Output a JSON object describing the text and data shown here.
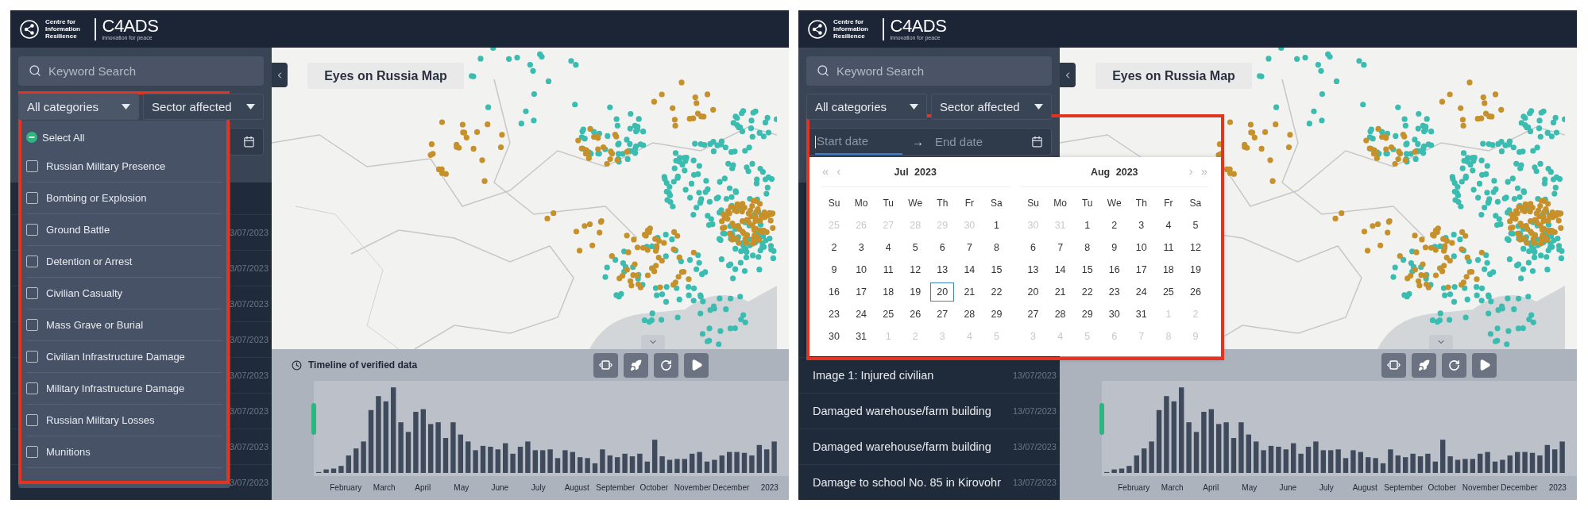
{
  "panels": [
    {
      "header": {
        "org_name": "Centre for Information Resilience",
        "brand": "C4ADS",
        "tagline": "innovation for peace"
      },
      "search": {
        "placeholder": "Keyword Search"
      },
      "filters": [
        {
          "label": "All categories",
          "open": true
        },
        {
          "label": "Sector affected",
          "open": false
        }
      ],
      "list": [
        {
          "date": "3/07/2023"
        },
        {
          "date": "3/07/2023"
        },
        {
          "date": "3/07/2023"
        },
        {
          "date": "3/07/2023"
        },
        {
          "date": "3/07/2023"
        },
        {
          "date": "3/07/2023"
        },
        {
          "date": "3/07/2023"
        },
        {
          "date": "3/07/2023"
        }
      ],
      "popup": {
        "kind": "category_menu",
        "annotated": true,
        "select_all": {
          "label": "Select All",
          "indeterminate": true
        },
        "options": [
          {
            "label": "Russian Military Presence",
            "checked": false
          },
          {
            "label": "Bombing or Explosion",
            "checked": false
          },
          {
            "label": "Ground Battle",
            "checked": false
          },
          {
            "label": "Detention or Arrest",
            "checked": false
          },
          {
            "label": "Civilian Casualty",
            "checked": false
          },
          {
            "label": "Mass Grave or Burial",
            "checked": false
          },
          {
            "label": "Civilian Infrastructure Damage",
            "checked": false
          },
          {
            "label": "Military Infrastructure Damage",
            "checked": false
          },
          {
            "label": "Russian Military Losses",
            "checked": false
          },
          {
            "label": "Munitions",
            "checked": false
          }
        ]
      },
      "map": {
        "title": "Eyes on Russia Map"
      },
      "timeline": {
        "title": "Timeline of verified data",
        "months": [
          "February",
          "March",
          "April",
          "May",
          "June",
          "July",
          "August",
          "September",
          "October",
          "November",
          "December",
          "2023"
        ]
      }
    },
    {
      "header": {
        "org_name": "Centre for Information Resilience",
        "brand": "C4ADS",
        "tagline": "innovation for peace"
      },
      "search": {
        "placeholder": "Keyword Search"
      },
      "filters": [
        {
          "label": "All categories",
          "open": false
        },
        {
          "label": "Sector affected",
          "open": false
        }
      ],
      "date_range": {
        "start_placeholder": "Start date",
        "separator": "→",
        "end_placeholder": "End date",
        "focused": true
      },
      "list": [
        {
          "title": "Image 1: Injured civilian",
          "date": "13/07/2023"
        },
        {
          "title": "Damaged warehouse/farm building",
          "date": "13/07/2023"
        },
        {
          "title": "Damaged warehouse/farm building",
          "date": "13/07/2023"
        },
        {
          "title": "Damage to school No. 85 in Kirovohr",
          "date": "13/07/2023"
        }
      ],
      "popup": {
        "kind": "calendar",
        "annotated": true,
        "months": [
          {
            "title": "Jul 2023",
            "nav": [
              "«",
              "‹"
            ],
            "weekdays": [
              "Su",
              "Mo",
              "Tu",
              "We",
              "Th",
              "Fr",
              "Sa"
            ],
            "weeks": [
              [
                {
                  "d": "25",
                  "muted": true,
                  "today": false
                },
                {
                  "d": "26",
                  "muted": true,
                  "today": false
                },
                {
                  "d": "27",
                  "muted": true,
                  "today": false
                },
                {
                  "d": "28",
                  "muted": true,
                  "today": false
                },
                {
                  "d": "29",
                  "muted": true,
                  "today": false
                },
                {
                  "d": "30",
                  "muted": true,
                  "today": false
                },
                {
                  "d": "1",
                  "muted": false,
                  "today": false
                }
              ],
              [
                {
                  "d": "2",
                  "muted": false,
                  "today": false
                },
                {
                  "d": "3",
                  "muted": false,
                  "today": false
                },
                {
                  "d": "4",
                  "muted": false,
                  "today": false
                },
                {
                  "d": "5",
                  "muted": false,
                  "today": false
                },
                {
                  "d": "6",
                  "muted": false,
                  "today": false
                },
                {
                  "d": "7",
                  "muted": false,
                  "today": false
                },
                {
                  "d": "8",
                  "muted": false,
                  "today": false
                }
              ],
              [
                {
                  "d": "9",
                  "muted": false,
                  "today": false
                },
                {
                  "d": "10",
                  "muted": false,
                  "today": false
                },
                {
                  "d": "11",
                  "muted": false,
                  "today": false
                },
                {
                  "d": "12",
                  "muted": false,
                  "today": false
                },
                {
                  "d": "13",
                  "muted": false,
                  "today": false
                },
                {
                  "d": "14",
                  "muted": false,
                  "today": false
                },
                {
                  "d": "15",
                  "muted": false,
                  "today": false
                }
              ],
              [
                {
                  "d": "16",
                  "muted": false,
                  "today": false
                },
                {
                  "d": "17",
                  "muted": false,
                  "today": false
                },
                {
                  "d": "18",
                  "muted": false,
                  "today": false
                },
                {
                  "d": "19",
                  "muted": false,
                  "today": false
                },
                {
                  "d": "20",
                  "muted": false,
                  "today": true
                },
                {
                  "d": "21",
                  "muted": false,
                  "today": false
                },
                {
                  "d": "22",
                  "muted": false,
                  "today": false
                }
              ],
              [
                {
                  "d": "23",
                  "muted": false,
                  "today": false
                },
                {
                  "d": "24",
                  "muted": false,
                  "today": false
                },
                {
                  "d": "25",
                  "muted": false,
                  "today": false
                },
                {
                  "d": "26",
                  "muted": false,
                  "today": false
                },
                {
                  "d": "27",
                  "muted": false,
                  "today": false
                },
                {
                  "d": "28",
                  "muted": false,
                  "today": false
                },
                {
                  "d": "29",
                  "muted": false,
                  "today": false
                }
              ],
              [
                {
                  "d": "30",
                  "muted": false,
                  "today": false
                },
                {
                  "d": "31",
                  "muted": false,
                  "today": false
                },
                {
                  "d": "1",
                  "muted": true,
                  "today": false
                },
                {
                  "d": "2",
                  "muted": true,
                  "today": false
                },
                {
                  "d": "3",
                  "muted": true,
                  "today": false
                },
                {
                  "d": "4",
                  "muted": true,
                  "today": false
                },
                {
                  "d": "5",
                  "muted": true,
                  "today": false
                }
              ]
            ]
          },
          {
            "title": "Aug 2023",
            "nav": [
              "›",
              "»"
            ],
            "weekdays": [
              "Su",
              "Mo",
              "Tu",
              "We",
              "Th",
              "Fr",
              "Sa"
            ],
            "weeks": [
              [
                {
                  "d": "30",
                  "muted": true,
                  "today": false
                },
                {
                  "d": "31",
                  "muted": true,
                  "today": false
                },
                {
                  "d": "1",
                  "muted": false,
                  "today": false
                },
                {
                  "d": "2",
                  "muted": false,
                  "today": false
                },
                {
                  "d": "3",
                  "muted": false,
                  "today": false
                },
                {
                  "d": "4",
                  "muted": false,
                  "today": false
                },
                {
                  "d": "5",
                  "muted": false,
                  "today": false
                }
              ],
              [
                {
                  "d": "6",
                  "muted": false,
                  "today": false
                },
                {
                  "d": "7",
                  "muted": false,
                  "today": false
                },
                {
                  "d": "8",
                  "muted": false,
                  "today": false
                },
                {
                  "d": "9",
                  "muted": false,
                  "today": false
                },
                {
                  "d": "10",
                  "muted": false,
                  "today": false
                },
                {
                  "d": "11",
                  "muted": false,
                  "today": false
                },
                {
                  "d": "12",
                  "muted": false,
                  "today": false
                }
              ],
              [
                {
                  "d": "13",
                  "muted": false,
                  "today": false
                },
                {
                  "d": "14",
                  "muted": false,
                  "today": false
                },
                {
                  "d": "15",
                  "muted": false,
                  "today": false
                },
                {
                  "d": "16",
                  "muted": false,
                  "today": false
                },
                {
                  "d": "17",
                  "muted": false,
                  "today": false
                },
                {
                  "d": "18",
                  "muted": false,
                  "today": false
                },
                {
                  "d": "19",
                  "muted": false,
                  "today": false
                }
              ],
              [
                {
                  "d": "20",
                  "muted": false,
                  "today": false
                },
                {
                  "d": "21",
                  "muted": false,
                  "today": false
                },
                {
                  "d": "22",
                  "muted": false,
                  "today": false
                },
                {
                  "d": "23",
                  "muted": false,
                  "today": false
                },
                {
                  "d": "24",
                  "muted": false,
                  "today": false
                },
                {
                  "d": "25",
                  "muted": false,
                  "today": false
                },
                {
                  "d": "26",
                  "muted": false,
                  "today": false
                }
              ],
              [
                {
                  "d": "27",
                  "muted": false,
                  "today": false
                },
                {
                  "d": "28",
                  "muted": false,
                  "today": false
                },
                {
                  "d": "29",
                  "muted": false,
                  "today": false
                },
                {
                  "d": "30",
                  "muted": false,
                  "today": false
                },
                {
                  "d": "31",
                  "muted": false,
                  "today": false
                },
                {
                  "d": "1",
                  "muted": true,
                  "today": false
                },
                {
                  "d": "2",
                  "muted": true,
                  "today": false
                }
              ],
              [
                {
                  "d": "3",
                  "muted": true,
                  "today": false
                },
                {
                  "d": "4",
                  "muted": true,
                  "today": false
                },
                {
                  "d": "5",
                  "muted": true,
                  "today": false
                },
                {
                  "d": "6",
                  "muted": true,
                  "today": false
                },
                {
                  "d": "7",
                  "muted": true,
                  "today": false
                },
                {
                  "d": "8",
                  "muted": true,
                  "today": false
                },
                {
                  "d": "9",
                  "muted": true,
                  "today": false
                }
              ]
            ]
          }
        ]
      },
      "map": {
        "title": "Eyes on Russia Map"
      },
      "timeline": {
        "months": [
          "February",
          "March",
          "April",
          "May",
          "June",
          "July",
          "August",
          "September",
          "October",
          "November",
          "December",
          "2023"
        ]
      }
    }
  ]
}
